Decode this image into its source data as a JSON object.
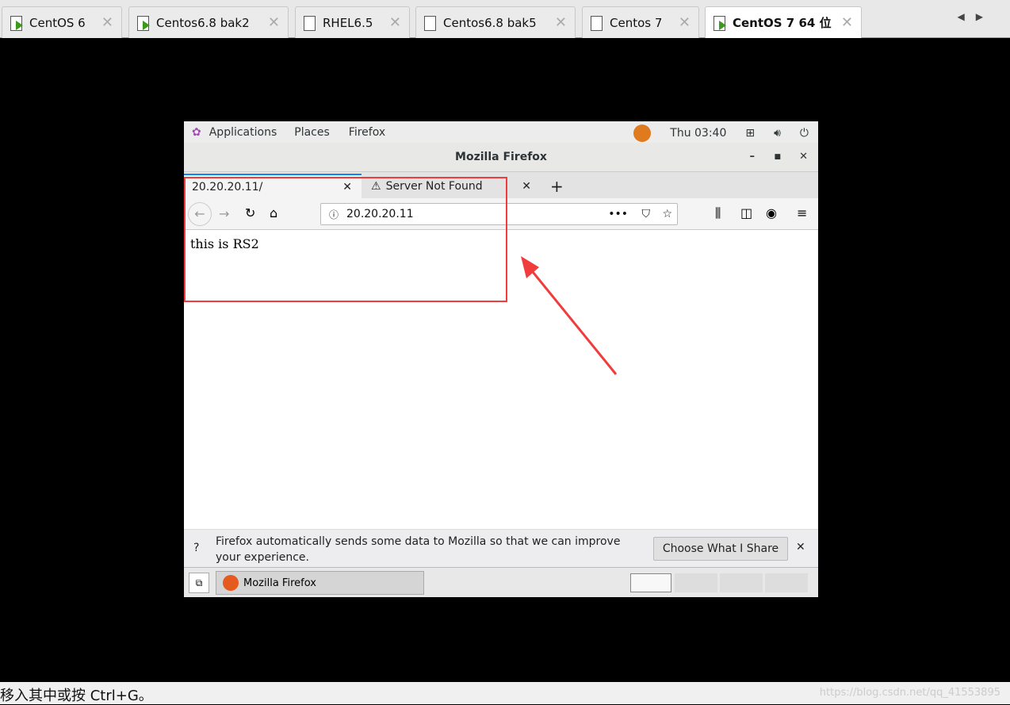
{
  "vm_tabs": [
    {
      "label": "CentOS 6",
      "icon": "vm-running-icon"
    },
    {
      "label": "Centos6.8 bak2",
      "icon": "vm-running-icon"
    },
    {
      "label": "RHEL6.5",
      "icon": "vm-icon"
    },
    {
      "label": "Centos6.8 bak5",
      "icon": "vm-icon"
    },
    {
      "label": "Centos 7",
      "icon": "vm-icon"
    },
    {
      "label": "CentOS 7 64 位",
      "icon": "vm-running-icon",
      "active": true
    }
  ],
  "gnome": {
    "applications": "Applications",
    "places": "Places",
    "firefox": "Firefox",
    "clock": "Thu 03:40"
  },
  "window": {
    "title": "Mozilla Firefox"
  },
  "browser": {
    "tabs": [
      {
        "label": "20.20.20.11/"
      },
      {
        "label": "Server Not Found",
        "icon": "warning-icon"
      }
    ],
    "url": "20.20.20.11",
    "content": "this is RS2"
  },
  "notification": {
    "text": "Firefox automatically sends some data to Mozilla so that we can improve your experience.",
    "button": "Choose What I Share"
  },
  "taskbar": {
    "item": "Mozilla Firefox"
  },
  "status": {
    "text": "移入其中或按 Ctrl+G。",
    "watermark": "https://blog.csdn.net/qq_41553895"
  },
  "colors": {
    "annotation": "#f03c3c",
    "tab_accent": "#0a84ff"
  }
}
